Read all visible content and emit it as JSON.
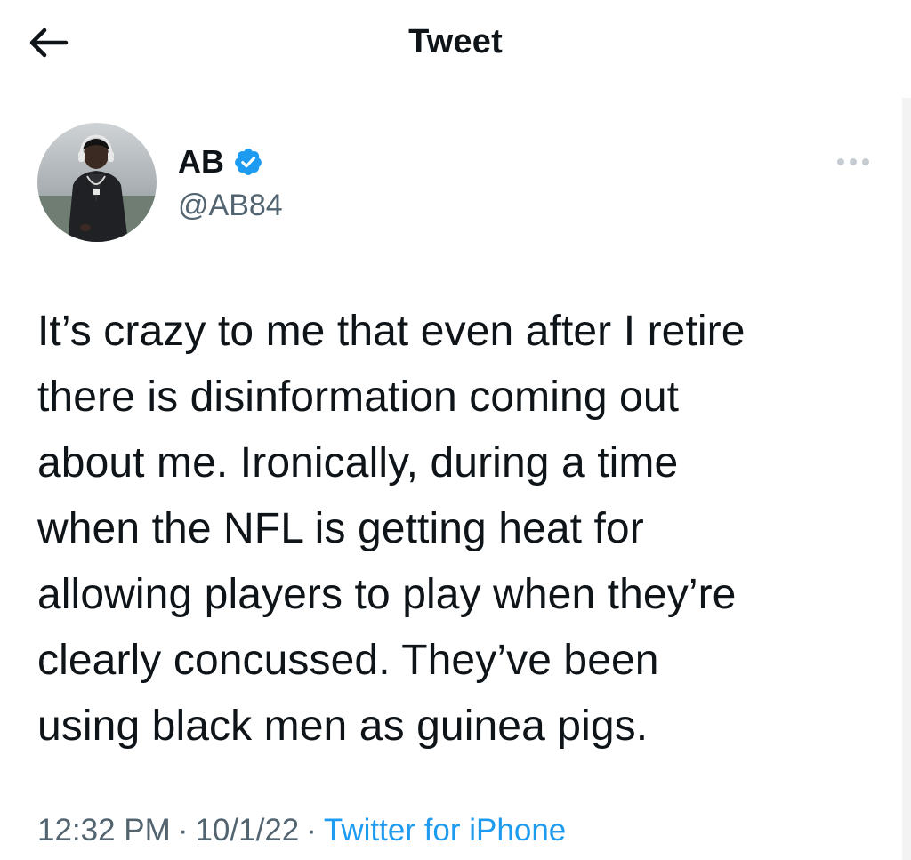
{
  "header": {
    "title": "Tweet",
    "back_icon": "arrow-left-icon"
  },
  "author": {
    "display_name": "AB",
    "handle": "@AB84",
    "verified": true,
    "verified_color": "#1d9bf0",
    "avatar": "profile-photo"
  },
  "more_icon": "more-horizontal-icon",
  "tweet": {
    "text": "It’s crazy to me that even after I retire there is disinformation coming out about me. Ironically, during a time when the NFL is getting heat for allowing players to play when they’re clearly concussed. They’ve been using black men as guinea pigs.",
    "lines": [
      "It’s crazy to me that even after I retire",
      "there is disinformation coming out",
      "about me. Ironically, during a time",
      "when the NFL is getting heat for",
      "allowing players to play when they’re",
      "clearly concussed. They’ve been",
      "using black men as guinea pigs."
    ]
  },
  "meta": {
    "time": "12:32 PM",
    "date": "10/1/22",
    "separator": "·",
    "source": "Twitter for iPhone",
    "source_color": "#1d9bf0"
  }
}
